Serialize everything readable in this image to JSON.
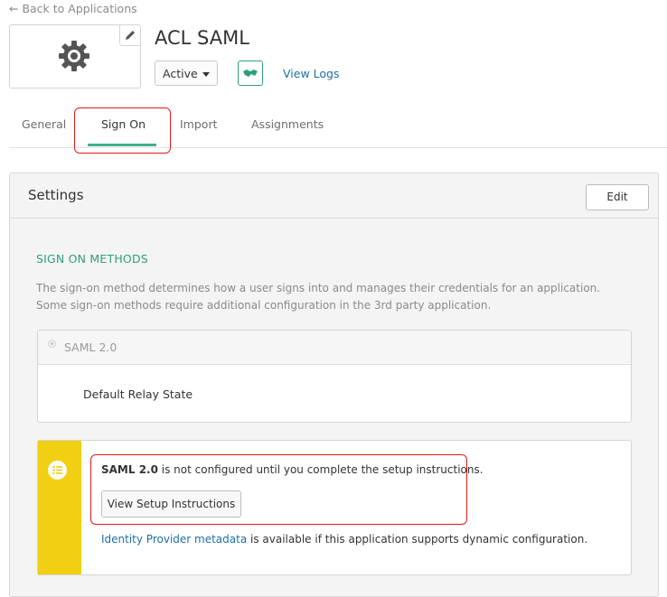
{
  "header": {
    "back_link": "← Back to Applications",
    "app_name": "ACL SAML",
    "status_value": "Active",
    "view_logs": "View Logs"
  },
  "tabs": [
    {
      "label": "General"
    },
    {
      "label": "Sign On",
      "active": true
    },
    {
      "label": "Import"
    },
    {
      "label": "Assignments"
    }
  ],
  "settings": {
    "title": "Settings",
    "edit_label": "Edit",
    "section_heading": "SIGN ON METHODS",
    "section_description": "The sign-on method determines how a user signs into and manages their credentials for an application. Some sign-on methods require additional configuration in the 3rd party application.",
    "method": {
      "label": "SAML 2.0",
      "relay_state_label": "Default Relay State"
    },
    "notice": {
      "bold_prefix": "SAML 2.0",
      "message_rest": " is not configured until you complete the setup instructions.",
      "setup_button": "View Setup Instructions",
      "metadata_link": "Identity Provider metadata",
      "metadata_rest": " is available if this application supports dynamic configuration."
    }
  },
  "colors": {
    "accent_green": "#3fb08d",
    "link_blue": "#1d6fa5",
    "warning_yellow": "#f1cf12",
    "highlight_red": "#e01a1a"
  },
  "icons": [
    "gear-icon",
    "pencil-icon",
    "handshake-icon",
    "list-icon"
  ]
}
